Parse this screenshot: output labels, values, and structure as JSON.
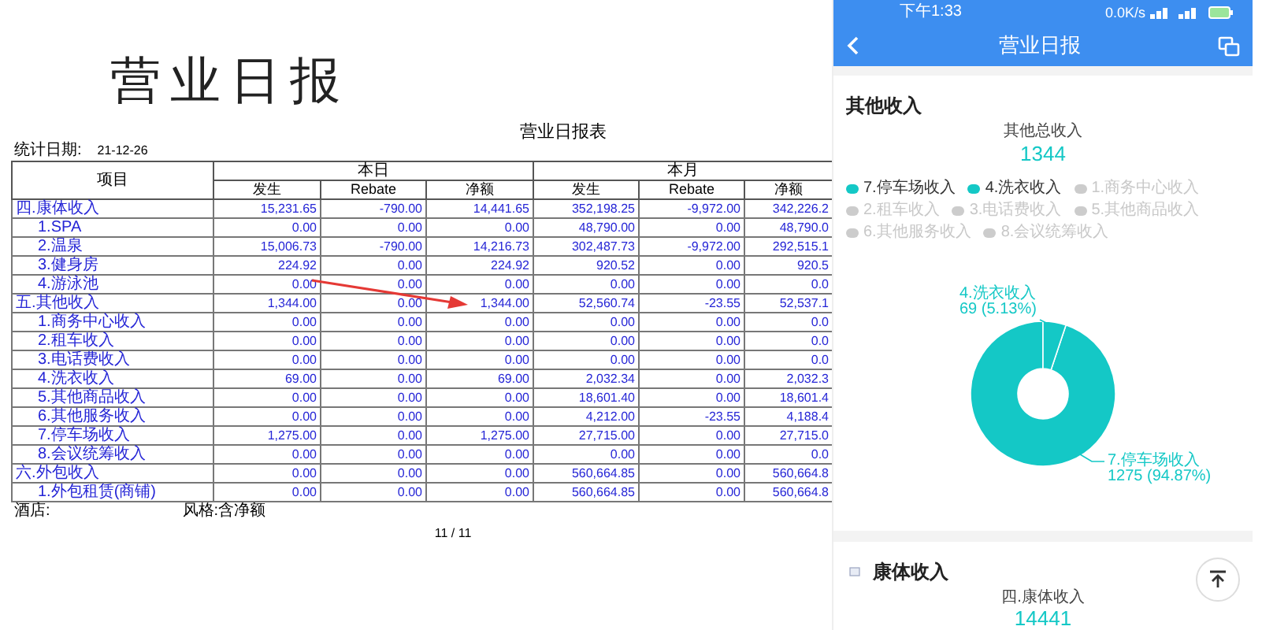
{
  "report": {
    "heading": "营业日报",
    "title": "营业日报表",
    "date_label": "统计日期:",
    "date": "21-12-26",
    "groups": [
      "本日",
      "本月"
    ],
    "columns": [
      "项目",
      "发生",
      "Rebate",
      "净额",
      "发生",
      "Rebate",
      "净额"
    ],
    "rows": [
      {
        "kind": "group",
        "cells": [
          "四.康体收入",
          "15,231.65",
          "-790.00",
          "14,441.65",
          "352,198.25",
          "-9,972.00",
          "342,226.2"
        ]
      },
      {
        "kind": "item",
        "cells": [
          "1.SPA",
          "0.00",
          "0.00",
          "0.00",
          "48,790.00",
          "0.00",
          "48,790.0"
        ]
      },
      {
        "kind": "item",
        "cells": [
          "2.温泉",
          "15,006.73",
          "-790.00",
          "14,216.73",
          "302,487.73",
          "-9,972.00",
          "292,515.1"
        ]
      },
      {
        "kind": "item",
        "cells": [
          "3.健身房",
          "224.92",
          "0.00",
          "224.92",
          "920.52",
          "0.00",
          "920.5"
        ]
      },
      {
        "kind": "item",
        "cells": [
          "4.游泳池",
          "0.00",
          "0.00",
          "0.00",
          "0.00",
          "0.00",
          "0.0"
        ]
      },
      {
        "kind": "group",
        "cells": [
          "五.其他收入",
          "1,344.00",
          "0.00",
          "1,344.00",
          "52,560.74",
          "-23.55",
          "52,537.1"
        ]
      },
      {
        "kind": "item",
        "cells": [
          "1.商务中心收入",
          "0.00",
          "0.00",
          "0.00",
          "0.00",
          "0.00",
          "0.0"
        ]
      },
      {
        "kind": "item",
        "cells": [
          "2.租车收入",
          "0.00",
          "0.00",
          "0.00",
          "0.00",
          "0.00",
          "0.0"
        ]
      },
      {
        "kind": "item",
        "cells": [
          "3.电话费收入",
          "0.00",
          "0.00",
          "0.00",
          "0.00",
          "0.00",
          "0.0"
        ]
      },
      {
        "kind": "item",
        "cells": [
          "4.洗衣收入",
          "69.00",
          "0.00",
          "69.00",
          "2,032.34",
          "0.00",
          "2,032.3"
        ]
      },
      {
        "kind": "item",
        "cells": [
          "5.其他商品收入",
          "0.00",
          "0.00",
          "0.00",
          "18,601.40",
          "0.00",
          "18,601.4"
        ]
      },
      {
        "kind": "item",
        "cells": [
          "6.其他服务收入",
          "0.00",
          "0.00",
          "0.00",
          "4,212.00",
          "-23.55",
          "4,188.4"
        ]
      },
      {
        "kind": "item",
        "cells": [
          "7.停车场收入",
          "1,275.00",
          "0.00",
          "1,275.00",
          "27,715.00",
          "0.00",
          "27,715.0"
        ]
      },
      {
        "kind": "item",
        "cells": [
          "8.会议统筹收入",
          "0.00",
          "0.00",
          "0.00",
          "0.00",
          "0.00",
          "0.0"
        ]
      },
      {
        "kind": "group",
        "cells": [
          "六.外包收入",
          "0.00",
          "0.00",
          "0.00",
          "560,664.85",
          "0.00",
          "560,664.8"
        ]
      },
      {
        "kind": "item",
        "cells": [
          "1.外包租赁(商铺)",
          "0.00",
          "0.00",
          "0.00",
          "560,664.85",
          "0.00",
          "560,664.8"
        ]
      }
    ],
    "footer_hotel": "酒店:",
    "footer_style": "风格:含净额",
    "page": "11 / 11"
  },
  "phone": {
    "status_time": "下午1:33",
    "status_speed": "0.0K/s",
    "title": "营业日报",
    "section": {
      "title": "其他收入",
      "total_label": "其他总收入",
      "total": "1344",
      "legend": [
        {
          "label": "7.停车场收入",
          "selected": true
        },
        {
          "label": "4.洗衣收入",
          "selected": true
        },
        {
          "label": "1.商务中心收入",
          "selected": false
        },
        {
          "label": "2.租车收入",
          "selected": false
        },
        {
          "label": "3.电话费收入",
          "selected": false
        },
        {
          "label": "5.其他商品收入",
          "selected": false
        },
        {
          "label": "6.其他服务收入",
          "selected": false
        },
        {
          "label": "8.会议统筹收入",
          "selected": false
        }
      ],
      "chart_data": {
        "type": "donut",
        "categories": [
          "7.停车场收入",
          "4.洗衣收入"
        ],
        "series": [
          {
            "color": "#14c8c6",
            "values": [
              94.87,
              5.13
            ]
          }
        ],
        "value_labels": [
          "1275 (94.87%)",
          "69 (5.13%)"
        ]
      }
    },
    "next_section": {
      "title": "康体收入",
      "total_label": "四.康体收入",
      "total": "14441"
    }
  }
}
